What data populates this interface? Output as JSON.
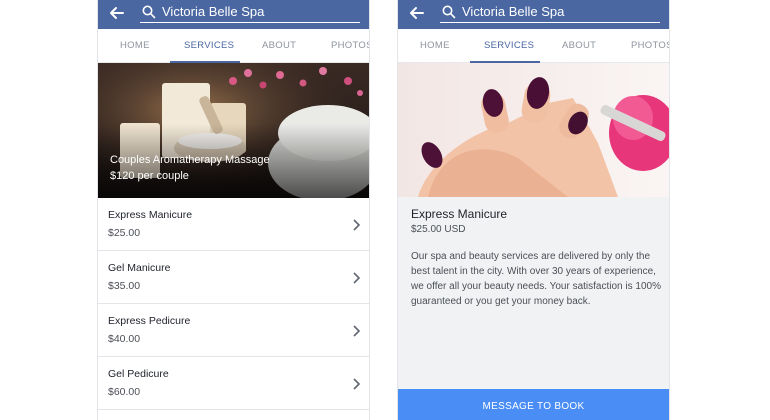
{
  "colors": {
    "header": "#4a67a1",
    "accent": "#4a67a1",
    "cta": "#4a8ef5"
  },
  "left": {
    "search_text": "Victoria Belle Spa",
    "tabs": [
      {
        "label": "HOME"
      },
      {
        "label": "SERVICES",
        "active": true
      },
      {
        "label": "ABOUT"
      },
      {
        "label": "PHOTOS"
      }
    ],
    "hero": {
      "title": "Couples Aromatherapy Massage",
      "price": "$120 per couple"
    },
    "services": [
      {
        "name": "Express Manicure",
        "price": "$25.00"
      },
      {
        "name": "Gel Manicure",
        "price": "$35.00"
      },
      {
        "name": "Express Pedicure",
        "price": "$40.00"
      },
      {
        "name": "Gel Pedicure",
        "price": "$60.00"
      }
    ]
  },
  "right": {
    "search_text": "Victoria Belle Spa",
    "tabs": [
      {
        "label": "HOME"
      },
      {
        "label": "SERVICES",
        "active": true
      },
      {
        "label": "ABOUT"
      },
      {
        "label": "PHOTOS"
      }
    ],
    "detail": {
      "title": "Express Manicure",
      "price": "$25.00 USD",
      "description": "Our spa and beauty services are delivered by only the best talent in the city. With over 30 years of experience, we offer all your beauty needs. Your satisfaction is 100% guaranteed or you get your money back."
    },
    "cta_label": "MESSAGE TO BOOK"
  }
}
